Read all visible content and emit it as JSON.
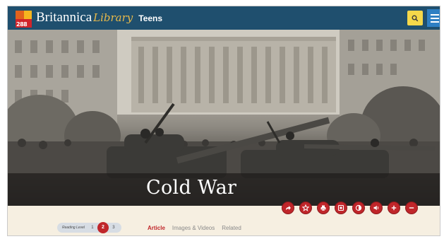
{
  "header": {
    "logo_number": "288",
    "brand_name": "Britannica",
    "brand_library": "Library",
    "brand_edition": "Teens",
    "search_icon": "search-icon",
    "menu_icon": "hamburger-menu-icon",
    "accent_yellow": "#f5d84a",
    "bar_color": "#1f4f6e"
  },
  "hero": {
    "title": "Cold War"
  },
  "actions": [
    {
      "name": "share-icon",
      "glyph": "↗"
    },
    {
      "name": "favorite-icon",
      "glyph": "☆"
    },
    {
      "name": "print-icon",
      "glyph": "⎙"
    },
    {
      "name": "save-icon",
      "glyph": "▣"
    },
    {
      "name": "translate-icon",
      "glyph": "◐"
    },
    {
      "name": "listen-icon",
      "glyph": "◀"
    },
    {
      "name": "increase-text-icon",
      "glyph": "+"
    },
    {
      "name": "decrease-text-icon",
      "glyph": "−"
    }
  ],
  "reading_level": {
    "label": "Reading Level",
    "levels": [
      "1",
      "2",
      "3"
    ],
    "selected": "2"
  },
  "tabs": [
    {
      "label": "Article",
      "active": true
    },
    {
      "label": "Images & Videos",
      "active": false
    },
    {
      "label": "Related",
      "active": false
    }
  ],
  "colors": {
    "accent_red": "#c0262a",
    "strip_background": "#f6efe1"
  }
}
